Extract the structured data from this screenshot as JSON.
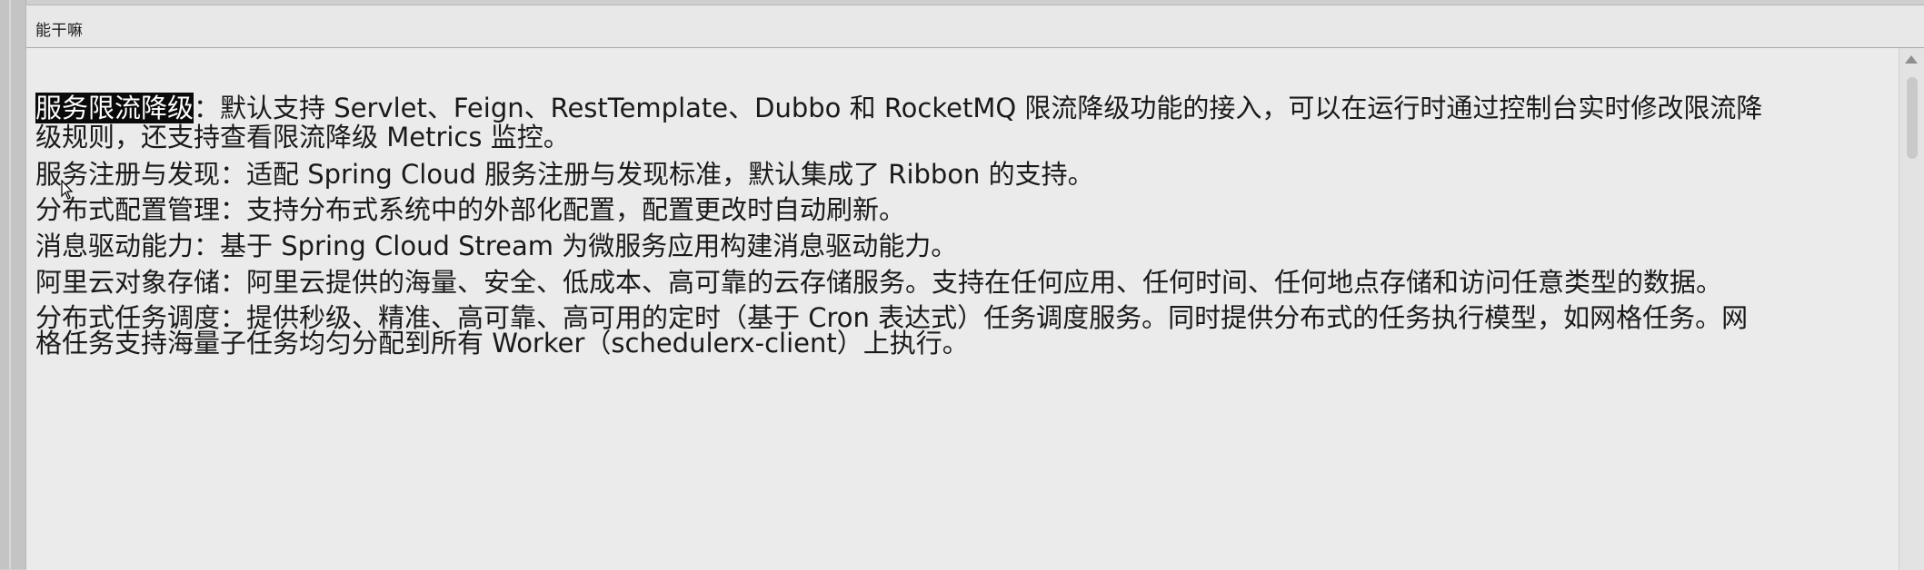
{
  "window": {
    "title": "能干嘛"
  },
  "features": [
    {
      "highlight": "服务限流降级",
      "line1": "：默认支持 Servlet、Feign、RestTemplate、Dubbo 和 RocketMQ 限流降级功能的接入，可以在运行时通过控制台实时修改限流降",
      "line2": "级规则，还支持查看限流降级 Metrics 监控。"
    },
    {
      "line1": "服务注册与发现：适配 Spring Cloud 服务注册与发现标准，默认集成了 Ribbon 的支持。"
    },
    {
      "line1": "分布式配置管理：支持分布式系统中的外部化配置，配置更改时自动刷新。"
    },
    {
      "line1": "消息驱动能力：基于 Spring Cloud Stream 为微服务应用构建消息驱动能力。"
    },
    {
      "line1": "阿里云对象存储：阿里云提供的海量、安全、低成本、高可靠的云存储服务。支持在任何应用、任何时间、任何地点存储和访问任意类型的数据。"
    },
    {
      "line1": "分布式任务调度：提供秒级、精准、高可靠、高可用的定时（基于 Cron 表达式）任务调度服务。同时提供分布式的任务执行模型，如网格任务。网",
      "line2": "格任务支持海量子任务均匀分配到所有 Worker（schedulerx-client）上执行。"
    }
  ],
  "colors": {
    "highlight_bg": "#0a0a0a",
    "highlight_fg": "#ffffff",
    "text": "#1a1a1a",
    "background": "#ebebeb"
  },
  "icons": {
    "scroll_up": "triangle-up",
    "cursor": "arrow-cursor"
  }
}
